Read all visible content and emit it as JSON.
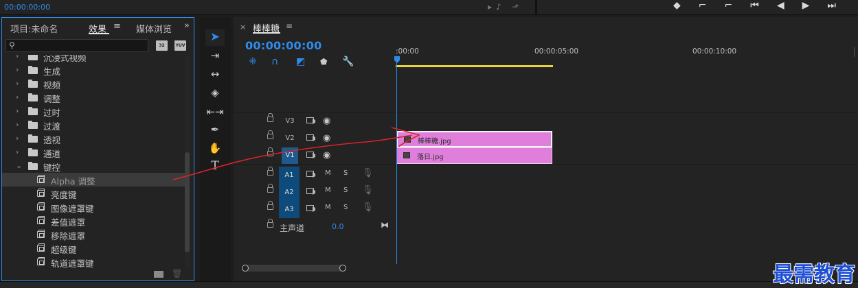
{
  "top": {
    "timecode": "00:00:00:00"
  },
  "panel": {
    "tabs": {
      "project": "项目:未命名",
      "effects": "效果",
      "menu": "≡",
      "media": "媒体浏览",
      "more": "»"
    },
    "badges": {
      "b32": "32",
      "yuv": "YUV"
    },
    "tree": [
      {
        "label": "沉浸式视频",
        "kind": "folder",
        "expanded": false
      },
      {
        "label": "生成",
        "kind": "folder",
        "expanded": false
      },
      {
        "label": "视频",
        "kind": "folder",
        "expanded": false
      },
      {
        "label": "调整",
        "kind": "folder",
        "expanded": false
      },
      {
        "label": "过时",
        "kind": "folder",
        "expanded": false
      },
      {
        "label": "过渡",
        "kind": "folder",
        "expanded": false
      },
      {
        "label": "透视",
        "kind": "folder",
        "expanded": false
      },
      {
        "label": "通道",
        "kind": "folder",
        "expanded": false
      },
      {
        "label": "键控",
        "kind": "folder",
        "expanded": true
      },
      {
        "label": "Alpha 调整",
        "kind": "effect",
        "selected": true
      },
      {
        "label": "亮度键",
        "kind": "effect"
      },
      {
        "label": "图像遮罩键",
        "kind": "effect"
      },
      {
        "label": "差值遮罩",
        "kind": "effect"
      },
      {
        "label": "移除遮罩",
        "kind": "effect"
      },
      {
        "label": "超级键",
        "kind": "effect"
      },
      {
        "label": "轨道遮罩键",
        "kind": "effect"
      }
    ]
  },
  "timeline": {
    "sequence_name": "棒棒糖",
    "menu": "≡",
    "timecode": "00:00:00:00",
    "ruler": [
      ":00:00",
      "00:00:05:00",
      "00:00:10:00"
    ],
    "video_tracks": [
      {
        "id": "V3",
        "target": false
      },
      {
        "id": "V2",
        "target": false
      },
      {
        "id": "V1",
        "target": true
      }
    ],
    "audio_tracks": [
      {
        "id": "A1",
        "m": "M",
        "s": "S"
      },
      {
        "id": "A2",
        "m": "M",
        "s": "S"
      },
      {
        "id": "A3",
        "m": "M",
        "s": "S"
      }
    ],
    "source_label": "V1",
    "clips": {
      "v2": "棒棒糖.jpg",
      "v1": "落日.jpg"
    },
    "master": {
      "label": "主声道",
      "value": "0.0"
    }
  },
  "colors": {
    "accent": "#2d8ceb",
    "clip": "#e07fdb",
    "workarea": "#e8d43a",
    "annotation": "#d6242a"
  },
  "watermark": "最需教育"
}
